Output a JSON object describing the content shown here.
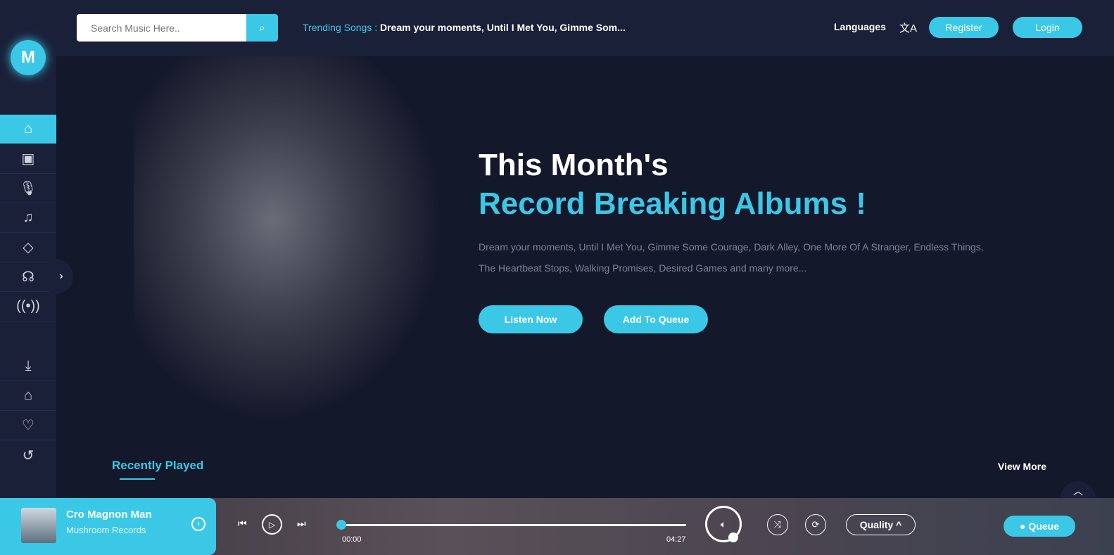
{
  "sidebar": {
    "logo": "M",
    "items": [
      "home-icon",
      "albums-icon",
      "microphone-icon",
      "music-folder-icon",
      "diamond-icon",
      "headphones-icon",
      "radio-icon"
    ],
    "bottom_items": [
      "download-icon",
      "shopping-bag-icon",
      "heart-icon",
      "history-icon"
    ]
  },
  "header": {
    "search_placeholder": "Search Music Here..",
    "trending_label": "Trending Songs :",
    "trending_songs": "Dream your moments, Until I Met You, Gimme Som...",
    "languages": "Languages",
    "register": "Register",
    "login": "Login"
  },
  "hero": {
    "title_line1": "This Month's",
    "title_line2": "Record Breaking Albums !",
    "description": "Dream your moments, Until I Met You, Gimme Some Courage, Dark Alley, One More Of A Stranger, Endless Things, The Heartbeat Stops, Walking Promises, Desired Games and many more...",
    "listen_now": "Listen Now",
    "add_to_queue": "Add To Queue"
  },
  "recent": {
    "title": "Recently Played",
    "view_more": "View More"
  },
  "player": {
    "track": "Cro Magnon Man",
    "artist": "Mushroom Records",
    "current_time": "00:00",
    "duration": "04:27",
    "progress": 0,
    "quality": "Quality",
    "queue": "Queue",
    "accent": "#3bc8e7"
  }
}
